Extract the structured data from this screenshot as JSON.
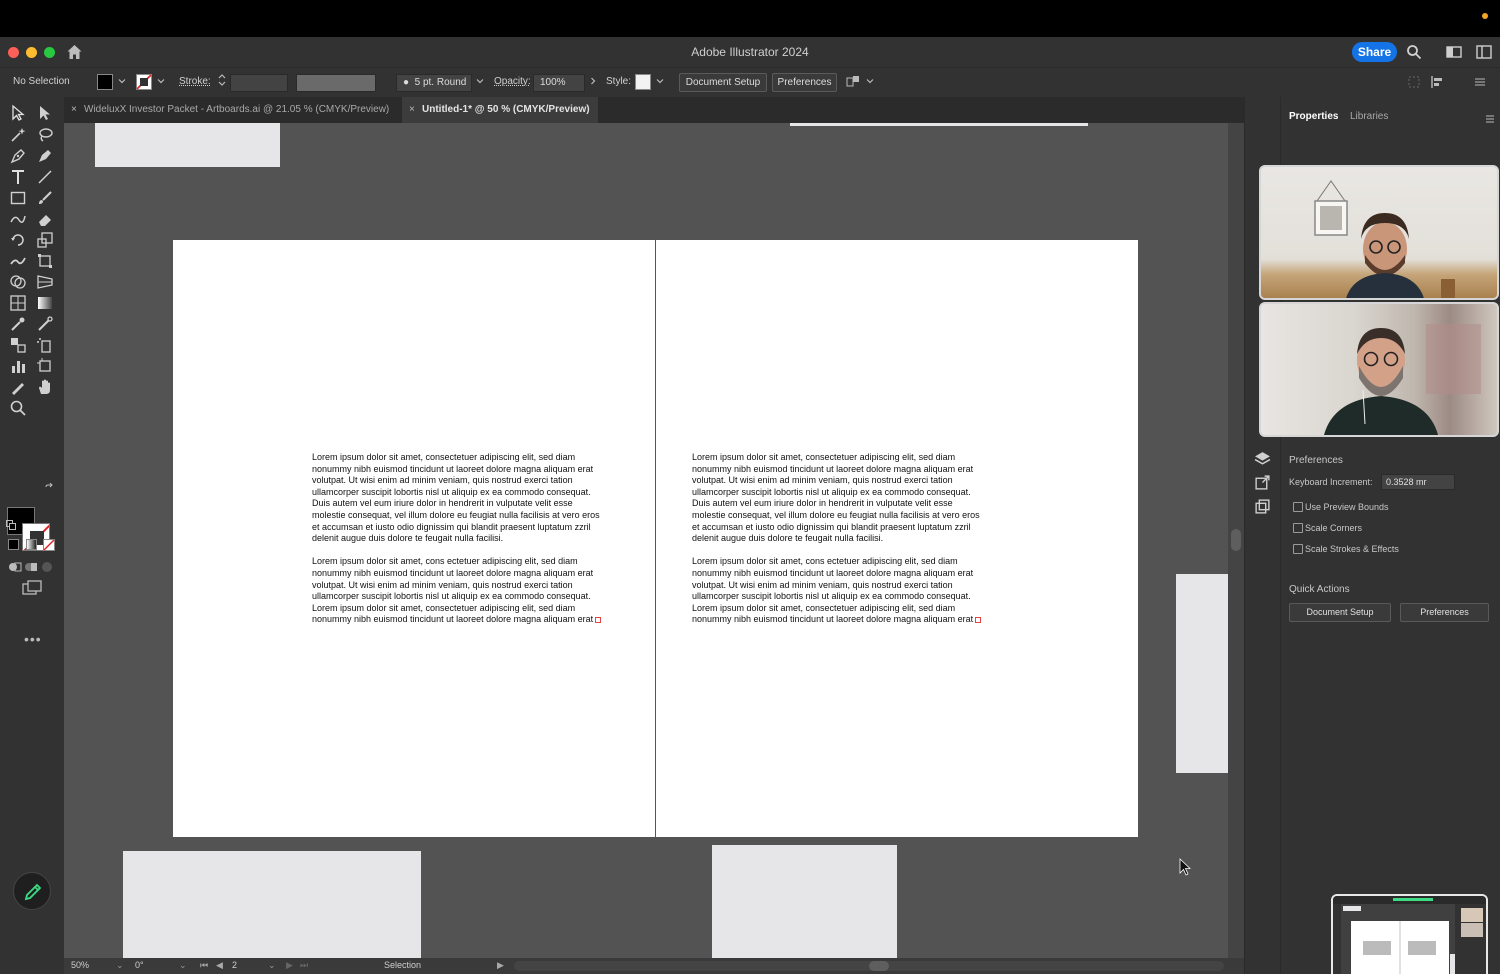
{
  "window": {
    "title": "Adobe Illustrator 2024",
    "share_label": "Share"
  },
  "control_bar": {
    "selection_status": "No Selection",
    "stroke_label": "Stroke:",
    "brush_label": "5 pt. Round",
    "opacity_label": "Opacity:",
    "opacity_value": "100%",
    "style_label": "Style:",
    "document_setup_label": "Document Setup",
    "preferences_label": "Preferences"
  },
  "tabs": [
    {
      "label": "WideluxX Investor Packet - Artboards.ai @ 21.05 % (CMYK/Preview)",
      "active": false
    },
    {
      "label": "Untitled-1* @ 50 % (CMYK/Preview)",
      "active": true
    }
  ],
  "artboards": {
    "left": {
      "paragraphs": [
        "Lorem ipsum dolor sit amet, consectetuer adipiscing elit, sed diam\nnonummy nibh euismod tincidunt ut laoreet dolore magna aliquam erat\nvolutpat. Ut wisi enim ad minim veniam, quis nostrud exerci tation\nullamcorper suscipit lobortis nisl ut aliquip ex ea commodo consequat.\nDuis autem vel eum iriure dolor in hendrerit in vulputate velit esse\nmolestie consequat, vel illum dolore eu feugiat nulla facilisis at vero eros\net accumsan et iusto odio dignissim qui blandit praesent luptatum zzril\ndelenit augue duis dolore te feugait nulla facilisi.",
        "Lorem ipsum dolor sit amet, cons ectetuer adipiscing elit, sed diam\nnonummy nibh euismod tincidunt ut laoreet dolore magna aliquam erat\nvolutpat. Ut wisi enim ad minim veniam, quis nostrud exerci tation\nullamcorper suscipit lobortis nisl ut aliquip ex ea commodo consequat.\nLorem ipsum dolor sit amet, consectetuer adipiscing elit, sed diam\nnonummy nibh euismod tincidunt ut laoreet dolore magna aliquam erat"
      ]
    },
    "right": {
      "paragraphs": [
        "Lorem ipsum dolor sit amet, consectetuer adipiscing elit, sed diam\nnonummy nibh euismod tincidunt ut laoreet dolore magna aliquam erat\nvolutpat. Ut wisi enim ad minim veniam, quis nostrud exerci tation\nullamcorper suscipit lobortis nisl ut aliquip ex ea commodo consequat.\nDuis autem vel eum iriure dolor in hendrerit in vulputate velit esse\nmolestie consequat, vel illum dolore eu feugiat nulla facilisis at vero eros\net accumsan et iusto odio dignissim qui blandit praesent luptatum zzril\ndelenit augue duis dolore te feugait nulla facilisi.",
        "Lorem ipsum dolor sit amet, cons ectetuer adipiscing elit, sed diam\nnonummy nibh euismod tincidunt ut laoreet dolore magna aliquam erat\nvolutpat. Ut wisi enim ad minim veniam, quis nostrud exerci tation\nullamcorper suscipit lobortis nisl ut aliquip ex ea commodo consequat.\nLorem ipsum dolor sit amet, consectetuer adipiscing elit, sed diam\nnonummy nibh euismod tincidunt ut laoreet dolore magna aliquam erat"
      ]
    }
  },
  "status_bar": {
    "zoom": "50%",
    "rotation": "0°",
    "artboard_number": "2",
    "tool_name": "Selection"
  },
  "properties_panel": {
    "tabs": [
      "Properties",
      "Libraries"
    ],
    "preferences_title": "Preferences",
    "keyboard_increment_label": "Keyboard Increment:",
    "keyboard_increment_value": "0.3528 mr",
    "checkboxes": [
      "Use Preview Bounds",
      "Scale Corners",
      "Scale Strokes & Effects"
    ],
    "quick_actions_title": "Quick Actions",
    "document_setup_label": "Document Setup",
    "preferences_label": "Preferences"
  },
  "colors": {
    "accent": "#1473e6",
    "ui_dark": "#323232",
    "canvas": "#535353"
  }
}
